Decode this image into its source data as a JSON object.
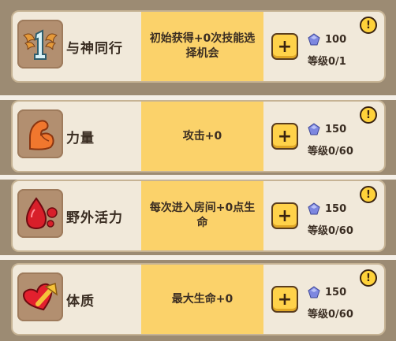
{
  "skills": [
    {
      "name": "与神同行",
      "description": "初始获得+0次技能选择机会",
      "cost": "100",
      "level": "等级0/1",
      "icon": "winged-one-icon"
    },
    {
      "name": "力量",
      "description": "攻击+0",
      "cost": "150",
      "level": "等级0/60",
      "icon": "flexed-arm-icon"
    },
    {
      "name": "野外活力",
      "description": "每次进入房间+0点生命",
      "cost": "150",
      "level": "等级0/60",
      "icon": "blood-drop-icon"
    },
    {
      "name": "体质",
      "description": "最大生命+0",
      "cost": "150",
      "level": "等级0/60",
      "icon": "heart-up-arrow-icon"
    }
  ],
  "buttons": {
    "upgrade_symbol": "+",
    "info_symbol": "!"
  },
  "colors": {
    "description_bg": "#fbd26a",
    "card_bg": "#f1e9da",
    "gem": "#7d87e0"
  }
}
